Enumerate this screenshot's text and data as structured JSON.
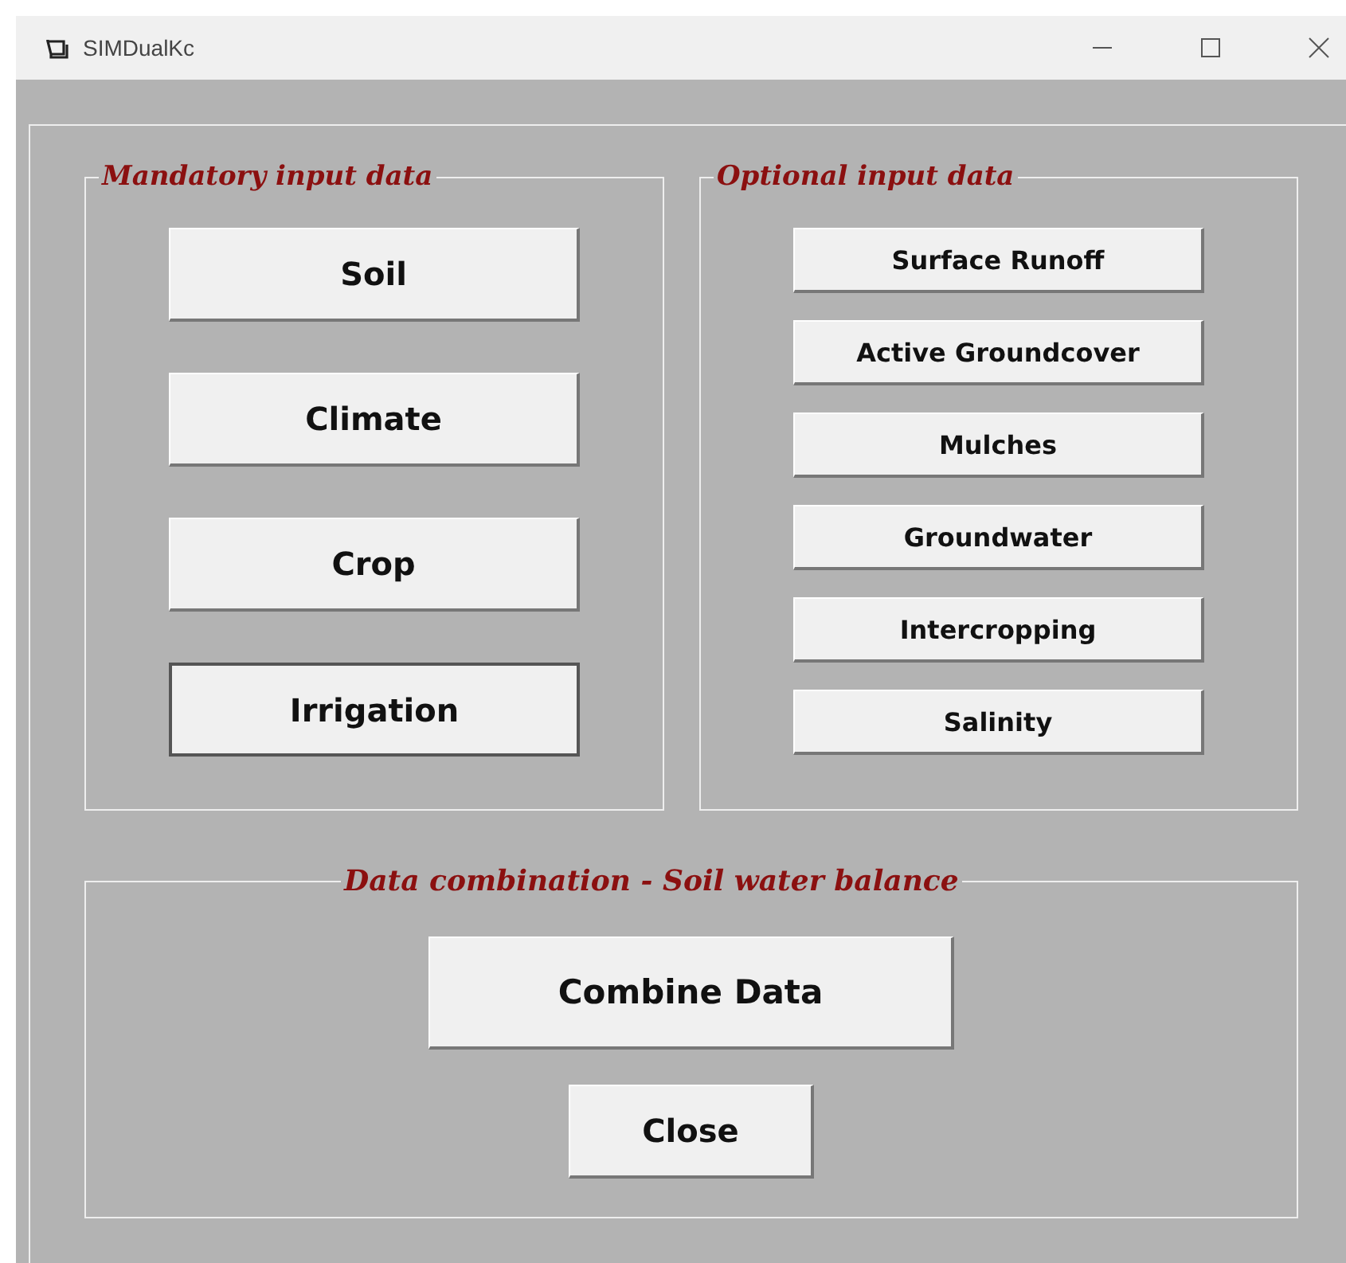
{
  "window": {
    "title": "SIMDualKc"
  },
  "mandatory": {
    "title": "Mandatory input data",
    "buttons": [
      {
        "label": "Soil",
        "focused": false
      },
      {
        "label": "Climate",
        "focused": false
      },
      {
        "label": "Crop",
        "focused": false
      },
      {
        "label": "Irrigation",
        "focused": true
      }
    ]
  },
  "optional": {
    "title": "Optional input data",
    "buttons": [
      {
        "label": "Surface Runoff"
      },
      {
        "label": "Active Groundcover"
      },
      {
        "label": "Mulches"
      },
      {
        "label": "Groundwater"
      },
      {
        "label": "Intercropping"
      },
      {
        "label": "Salinity"
      }
    ]
  },
  "combination": {
    "title": "Data combination - Soil water balance",
    "buttons": [
      {
        "label": "Combine Data",
        "kind": "large"
      },
      {
        "label": "Close",
        "kind": "small"
      }
    ]
  }
}
